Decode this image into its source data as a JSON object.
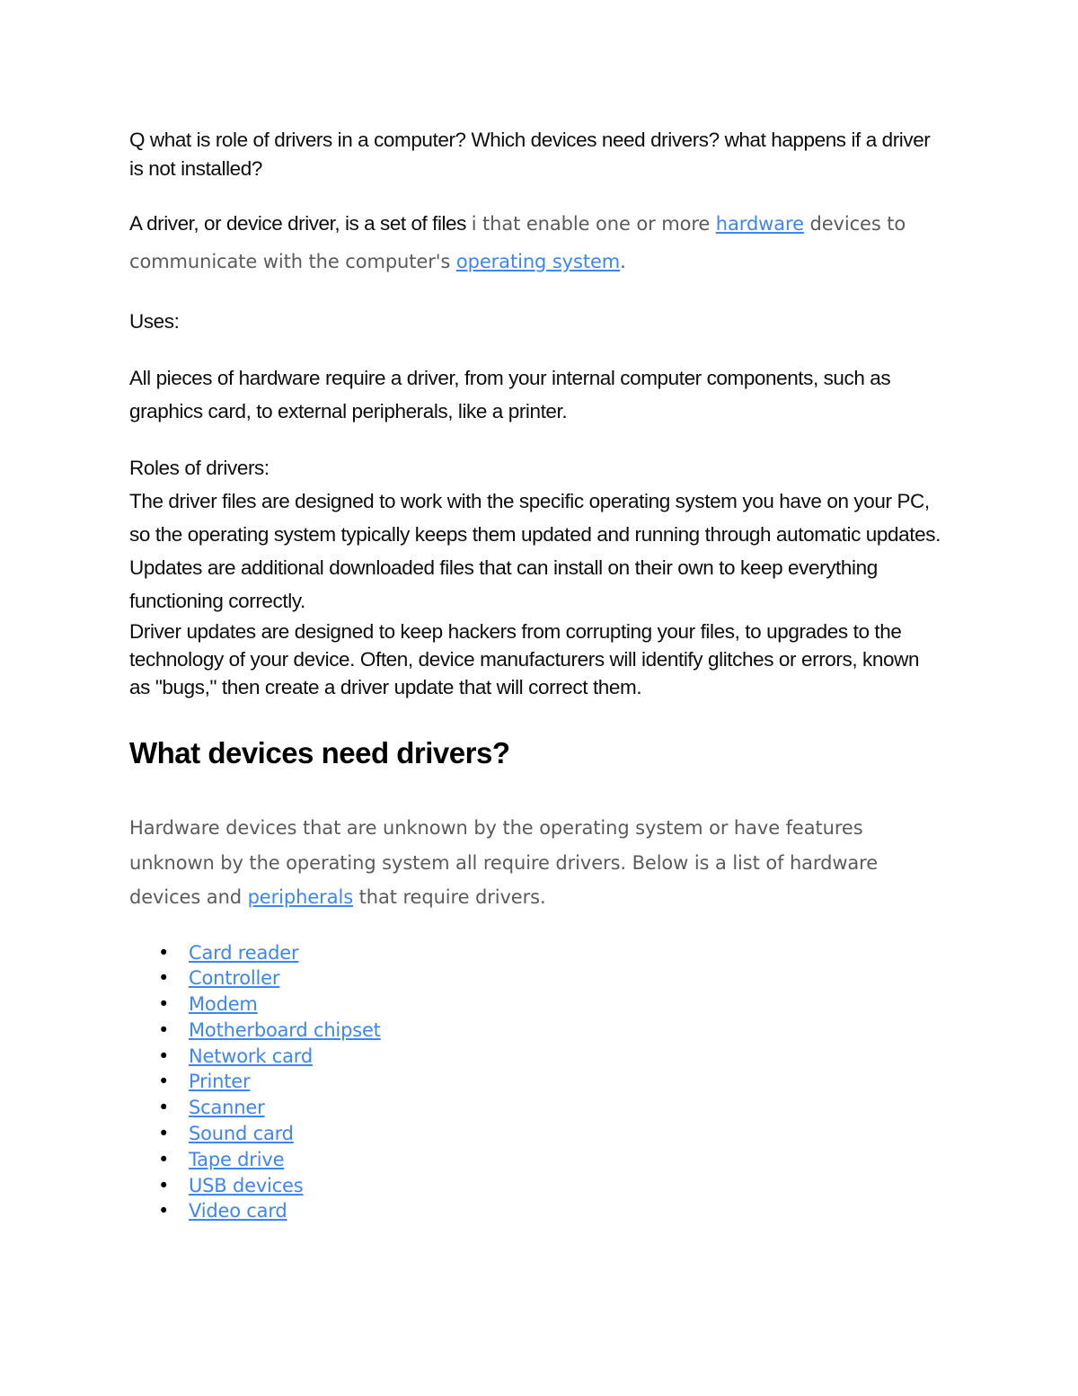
{
  "document": {
    "question": "Q what is role of drivers in a computer? Which devices need drivers? what happens if a driver is not installed?",
    "definition": {
      "lead_dark": "A driver, or device driver, is a set of files ",
      "grey_part_1": "i that enable one or more ",
      "link_hardware": "hardware",
      "grey_part_2": " devices to communicate with the computer's ",
      "link_operating_system": "operating system",
      "grey_part_3": "."
    },
    "uses_label": "Uses:",
    "uses_body": "All pieces of hardware require a driver, from your internal computer components, such as graphics card, to external peripherals, like a printer.",
    "roles_label": "Roles of drivers:",
    "roles_body": "The driver files are designed to work with the specific operating system you have on your PC, so the operating system typically keeps them updated and running through automatic updates. Updates are additional downloaded files that can install on their own to keep everything functioning correctly.",
    "driver_updates_body": "Driver updates are  designed to keep hackers from corrupting your files, to upgrades to the technology of your device. Often, device manufacturers will identify glitches or errors, known as \"bugs,\" then create a driver update that will correct them.",
    "heading_devices": "What devices need drivers?",
    "devices_intro": {
      "part_1": "Hardware devices that are unknown by the operating system or have features unknown by the operating system all require drivers. Below is a list of hardware devices and ",
      "link_peripherals": "peripherals",
      "part_2": " that require drivers."
    },
    "bullet_glyph": "•",
    "device_list": [
      "Card reader",
      "Controller",
      "Modem",
      "Motherboard chipset",
      "Network card",
      "Printer",
      "Scanner",
      "Sound card",
      "Tape drive",
      "USB devices",
      "Video card"
    ]
  },
  "colors": {
    "link_blue": "#3d86f2",
    "body_dark": "#0d0d0d",
    "body_grey": "#5b5b5b",
    "background": "#ffffff"
  }
}
